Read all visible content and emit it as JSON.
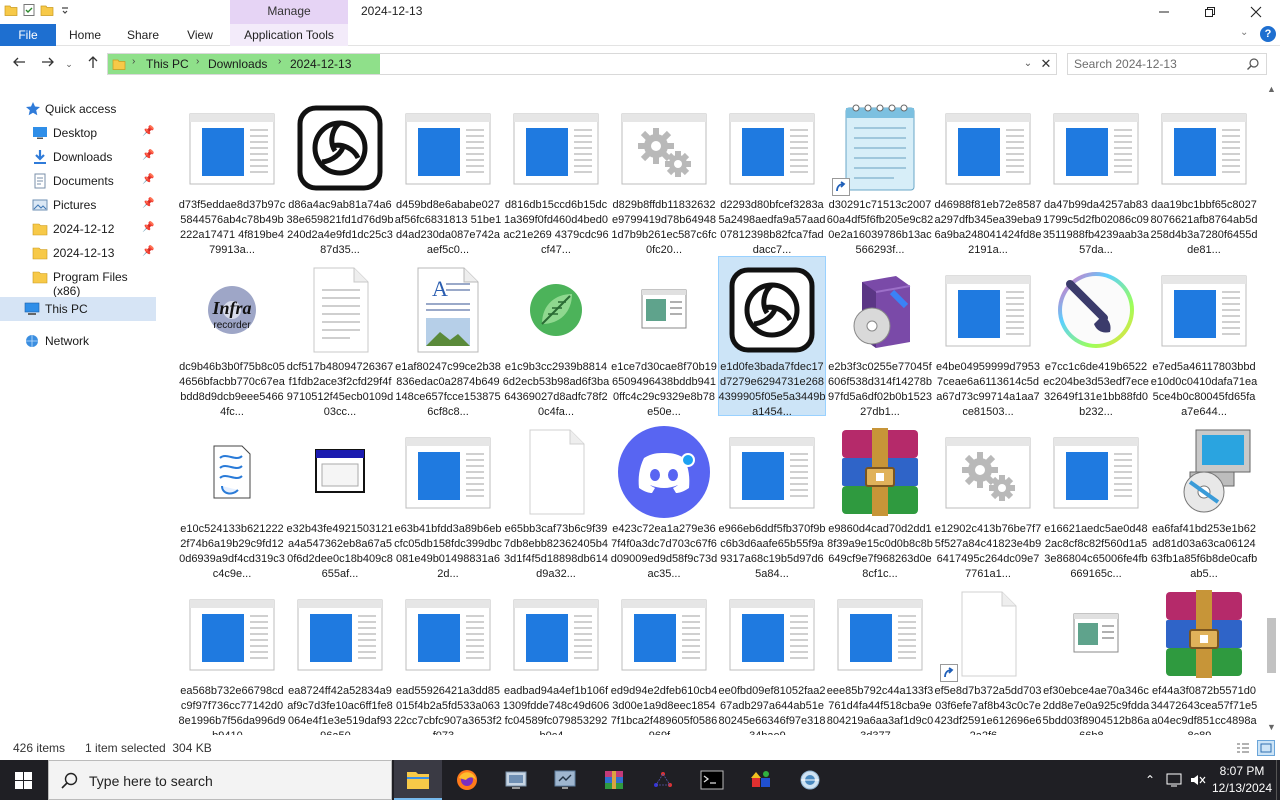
{
  "titlebar": {
    "manage_label": "Manage",
    "title": "2024-12-13"
  },
  "ribbon": {
    "tabs": [
      {
        "label": "File"
      },
      {
        "label": "Home"
      },
      {
        "label": "Share"
      },
      {
        "label": "View"
      },
      {
        "label": "Application Tools"
      }
    ],
    "help": "?"
  },
  "address": {
    "crumbs": [
      "This PC",
      "Downloads",
      "2024-12-13"
    ],
    "search_placeholder": "Search 2024-12-13"
  },
  "nav": {
    "items": [
      {
        "label": "Quick access",
        "icon": "star-icon"
      },
      {
        "label": "Desktop",
        "icon": "desktop-icon",
        "pinned": true
      },
      {
        "label": "Downloads",
        "icon": "download-icon",
        "pinned": true
      },
      {
        "label": "Documents",
        "icon": "documents-icon",
        "pinned": true
      },
      {
        "label": "Pictures",
        "icon": "pictures-icon",
        "pinned": true
      },
      {
        "label": "2024-12-12",
        "icon": "folder-icon",
        "pinned": true
      },
      {
        "label": "2024-12-13",
        "icon": "folder-icon",
        "pinned": true
      },
      {
        "label": "Program Files (x86)",
        "icon": "folder-icon"
      },
      {
        "label": "This PC",
        "icon": "computer-icon"
      },
      {
        "label": "Network",
        "icon": "network-icon"
      }
    ]
  },
  "files": [
    {
      "name": "d73f5eddae8d37b97c5844576ab4c78b49b222a17471 4f819be479913a...",
      "icon": "app-window-icon"
    },
    {
      "name": "d86a4ac9ab81a74a638e659821fd1d76d9b240d2a4e9fd1dc25c387d35...",
      "icon": "openai-logo-icon"
    },
    {
      "name": "d459bd8e6ababe027af56fc6831813 51be1d4ad230da087e742aaef5c0...",
      "icon": "app-window-icon"
    },
    {
      "name": "d816db15ccd6b15dc1a369f0fd460d4bed0ac21e269 4379cdc96cf47...",
      "icon": "app-window-icon"
    },
    {
      "name": "d829b8ffdb11832632e9799419d78b649481d7b9b261ec587c6fc0fc20...",
      "icon": "gears-icon"
    },
    {
      "name": "d2293d80bfcef3283a5a2498aedfa9a57aad07812398b82fca7faddacc7...",
      "icon": "app-window-icon"
    },
    {
      "name": "d30291c71513c200760a4df5f6fb205e9c820e2a16039786b13ac566293f...",
      "icon": "notepad-icon",
      "shortcut": true
    },
    {
      "name": "d46988f81eb72e8587a297dfb345ea39eba96a9ba248041424fd8e2191a...",
      "icon": "app-window-icon"
    },
    {
      "name": "da47b99da4257ab831799c5d2fb02086c093511988fb4239aab3a57da...",
      "icon": "app-window-icon"
    },
    {
      "name": "daa19bc1bbf65c80278076621afb8764ab5d258d4b3a7280f6455dde81...",
      "icon": "app-window-icon"
    },
    {
      "name": "dc9b46b3b0f75b8c054656bfacbb770c67eabdd8d9dcb9eee54664fc...",
      "icon": "infrarecorder-icon"
    },
    {
      "name": "dcf517b48094726367f1fdb2ace3f2cfd29f4f9710512f45ecb0109d03cc...",
      "icon": "text-doc-icon"
    },
    {
      "name": "e1af80247c99ce2b38836edac0a2874b649148ce657fcce1538756cf8c8...",
      "icon": "wordpad-doc-icon"
    },
    {
      "name": "e1c9b3cc2939b88146d2ecb53b98ad6f3ba64369027d8adfc78f20c4fa...",
      "icon": "leaf-app-icon"
    },
    {
      "name": "e1ce7d30cae8f70b196509496438bddb9410ffc4c29c9329e8b78e50e...",
      "icon": "small-window-icon"
    },
    {
      "name": "e1d0fe3bada7fdec17d7279e6294731e2684399905f05e5a3449ba1454...",
      "icon": "openai-logo-icon",
      "selected": true
    },
    {
      "name": "e2b3f3c0255e77045f606f538d314f14278b97fd5a6df02b0b152327db1...",
      "icon": "installer-box-icon"
    },
    {
      "name": "e4be04959999d79537ceae6a6113614c5da67d73c99714a1aa7ce81503...",
      "icon": "app-window-icon"
    },
    {
      "name": "e7cc1c6de419b6522ec204be3d53edf7ece32649f131e1bb88fd0b232...",
      "icon": "paint-brush-icon"
    },
    {
      "name": "e7ed5a46117803bbde10d0c0410dafa71ea5ce4b0c80045fd65faa7e644...",
      "icon": "app-window-icon"
    },
    {
      "name": "e10c524133b6212222f74b6a19b29c9fd120d6939a9df4cd319c3c4c9e...",
      "icon": "script-doc-icon"
    },
    {
      "name": "e32b43fe4921503121a4a547362eb8a67a50f6d2dee0c18b409c8655af...",
      "icon": "dialog-window-icon"
    },
    {
      "name": "e63b41bfdd3a89b6ebcfc05db158fdc399dbc081e49b01498831a62d...",
      "icon": "app-window-icon"
    },
    {
      "name": "e65bb3caf73b6c9f397db8ebb82362405b43d1f4f5d18898db614d9a32...",
      "icon": "blank-doc-icon"
    },
    {
      "name": "e423c72ea1a279e367f4f0a3dc7d703c67f6d09009ed9d58f9c73dac35...",
      "icon": "discord-icon"
    },
    {
      "name": "e966eb6ddf5fb370f9bc6b3d6aafe65b55f9a9317a68c19b5d97d65a84...",
      "icon": "app-window-icon"
    },
    {
      "name": "e9860d4cad70d2dd18f39a9e15c0d0b8c8b649cf9e7f968263d0e8cf1c...",
      "icon": "winrar-icon"
    },
    {
      "name": "e12902c413b76be7f75f527a84c41823e4b96417495c264dc09e77761a1...",
      "icon": "gears-icon"
    },
    {
      "name": "e16621aedc5ae0d482ac8cf8c82f560d1a53e86804c65006fe4fb669165c...",
      "icon": "app-window-icon"
    },
    {
      "name": "ea6faf41bd253e1b62ad81d03a63ca0612463fb1a85f6b8de0cafbab5...",
      "icon": "computer-cd-icon"
    },
    {
      "name": "ea568b732e66798cdc9f97f736cc77142d08e1996b7f56da996d9b9410...",
      "icon": "app-window-icon"
    },
    {
      "name": "ea8724ff42a52834a9af9c7d3fe10ac6ff1fe8064e4f1e3e519daf9396a50...",
      "icon": "app-window-icon"
    },
    {
      "name": "ead55926421a3dd85015f4b2a5fd533a06322cc7cbfc907a3653f2f073...",
      "icon": "app-window-icon"
    },
    {
      "name": "eadbad94a4ef1b106f1309fdde748c49d606fc04589fc079853292b0c4...",
      "icon": "app-window-icon"
    },
    {
      "name": "ed9d94e2dfeb610cb43d00e1a9d8eec18547f1bca2f489605f0586969f...",
      "icon": "app-window-icon"
    },
    {
      "name": "ee0fbd09ef81052faa267adb297a644ab51e80245e66346f97e31834bae9...",
      "icon": "app-window-icon"
    },
    {
      "name": "eee85b792c44a133f3761d4fa44f518cba9e804219a6aa3af1d9c03d377...",
      "icon": "app-window-icon"
    },
    {
      "name": "ef5e8d7b372a5dd70303f6efe7af8b43c0c7e423df2591e612696e62a2f6...",
      "icon": "blank-doc-icon",
      "shortcut": true
    },
    {
      "name": "ef30ebce4ae70a346c2dd8e7e0a925c9fdda5bdd03f8904512b86a66b8...",
      "icon": "small-window-icon"
    },
    {
      "name": "ef44a3f0872b5571d034472643cea57f71e5a04ec9df851cc4898a8c89...",
      "icon": "winrar-icon"
    }
  ],
  "status": {
    "item_count": "426 items",
    "selection": "1 item selected  304 KB"
  },
  "taskbar": {
    "search_placeholder": "Type here to search",
    "time": "8:07 PM",
    "date": "12/13/2024"
  },
  "colors": {
    "accent": "#1e6fd0",
    "manage_tab": "#e6d4f5",
    "breadcrumb_highlight": "#8fe08a",
    "selection": "#cce4f7",
    "taskbar": "#1f1f24"
  }
}
